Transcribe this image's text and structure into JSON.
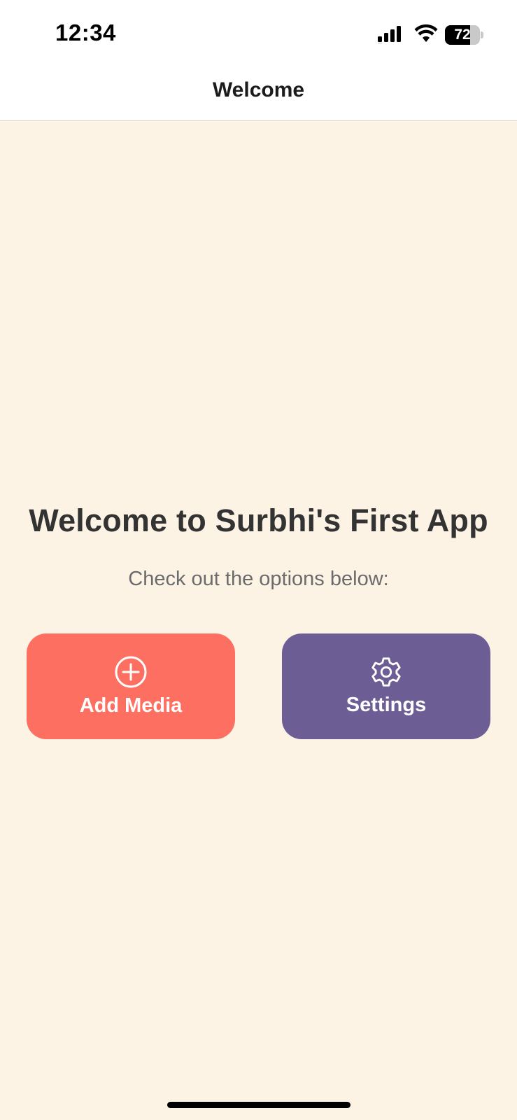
{
  "status_bar": {
    "time": "12:34",
    "battery_level": "72",
    "icons": [
      "signal-icon",
      "wifi-icon",
      "battery-icon"
    ]
  },
  "nav": {
    "title": "Welcome"
  },
  "main": {
    "heading": "Welcome to Surbhi's First App",
    "subtitle": "Check out the options below:",
    "buttons": [
      {
        "label": "Add Media",
        "icon": "plus-circle-icon",
        "color": "#fd6f60"
      },
      {
        "label": "Settings",
        "icon": "gear-icon",
        "color": "#6c5d95"
      }
    ]
  },
  "colors": {
    "background": "#fcf3e5",
    "heading": "#333333",
    "subtitle": "#6b6b6b"
  }
}
